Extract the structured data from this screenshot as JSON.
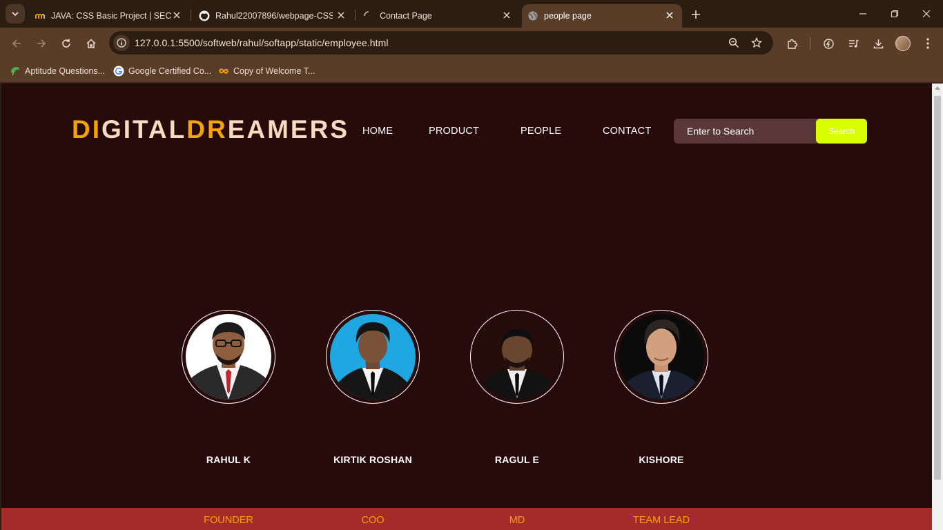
{
  "browser": {
    "tabs": [
      {
        "title": "JAVA: CSS Basic Project | SEC",
        "icon": "moodle-icon"
      },
      {
        "title": "Rahul22007896/webpage-CSS-",
        "icon": "github-icon"
      },
      {
        "title": "Contact Page",
        "icon": "loading-spinner-icon"
      },
      {
        "title": "people page",
        "icon": "globe-icon",
        "active": true
      }
    ],
    "url": "127.0.0.1:5500/softweb/rahul/softapp/static/employee.html",
    "bookmarks": [
      {
        "label": "Aptitude Questions...",
        "icon": "leaf-icon"
      },
      {
        "label": "Google Certified Co...",
        "icon": "google-icon"
      },
      {
        "label": "Copy of Welcome T...",
        "icon": "infinity-icon"
      }
    ]
  },
  "site": {
    "logo_parts": [
      "DI",
      "GITAL",
      "DR",
      "EAMERS"
    ],
    "nav": [
      "HOME",
      "PRODUCT",
      "PEOPLE",
      "CONTACT"
    ],
    "search": {
      "placeholder": "Enter to Search",
      "button": "Search"
    },
    "people": [
      {
        "name": "RAHUL K",
        "role": "FOUNDER"
      },
      {
        "name": "KIRTIK ROSHAN",
        "role": "COO"
      },
      {
        "name": "RAGUL E",
        "role": "MD"
      },
      {
        "name": "KISHORE",
        "role": "TEAM LEAD"
      }
    ]
  },
  "colors": {
    "page_bg": "#270a0a",
    "accent_orange": "#f4a306",
    "logo_cream": "#f5dcc0",
    "search_button": "#d8ff00",
    "role_bar": "#a52a2a"
  }
}
